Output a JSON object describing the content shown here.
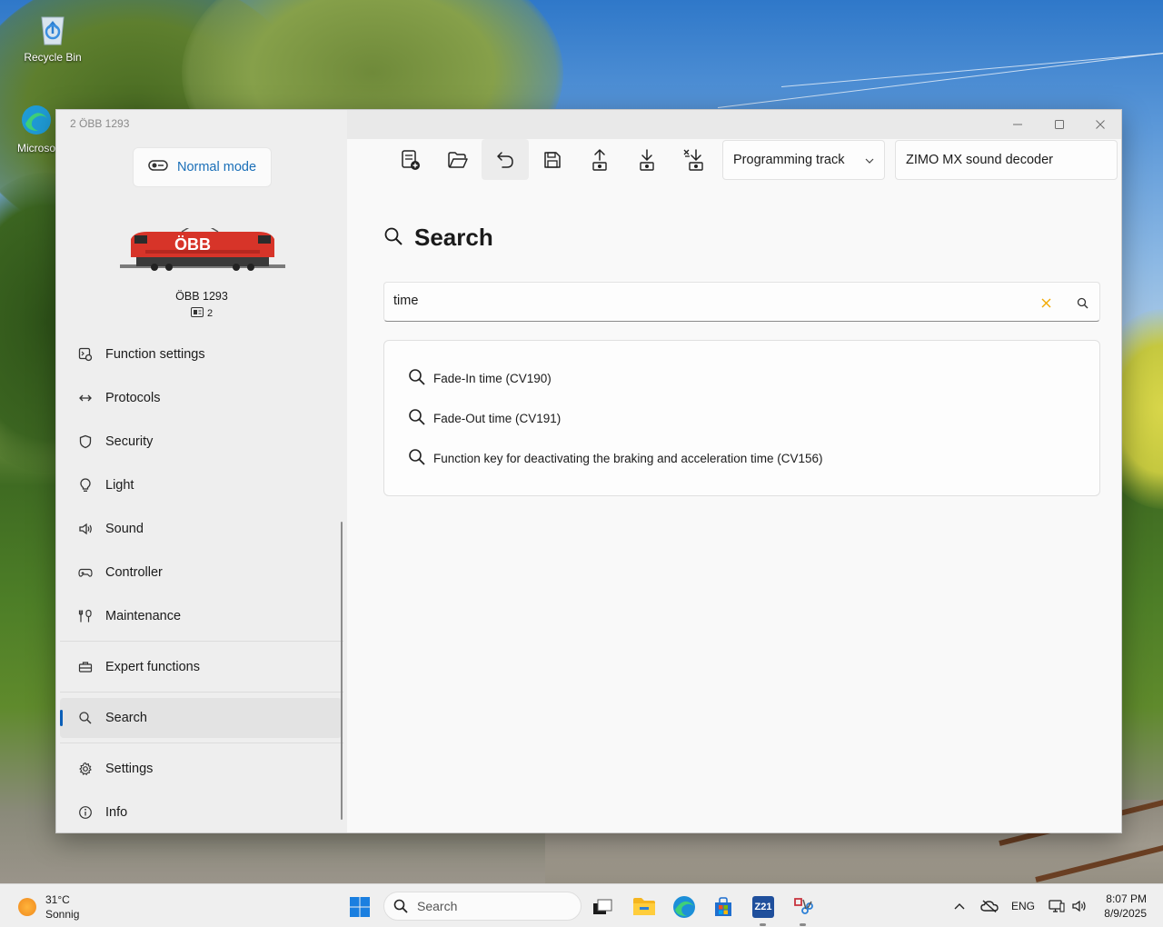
{
  "desktop": {
    "icons": [
      {
        "label": "Recycle Bin"
      },
      {
        "label": "Microso"
      }
    ]
  },
  "window": {
    "title": "2 ÖBB 1293",
    "controls": {
      "minimize": "minimize",
      "maximize": "maximize",
      "close": "close"
    }
  },
  "sidebar": {
    "mode_label": "Normal mode",
    "loco": {
      "name": "ÖBB 1293",
      "address": "2",
      "logo_text": "ÖBB"
    },
    "items": [
      {
        "label": "Function settings",
        "icon": "function-settings-icon"
      },
      {
        "label": "Protocols",
        "icon": "protocols-icon"
      },
      {
        "label": "Security",
        "icon": "shield-icon"
      },
      {
        "label": "Light",
        "icon": "lightbulb-icon"
      },
      {
        "label": "Sound",
        "icon": "speaker-icon"
      },
      {
        "label": "Controller",
        "icon": "gamepad-icon"
      },
      {
        "label": "Maintenance",
        "icon": "wrench-icon"
      },
      {
        "label": "Expert functions",
        "icon": "toolbox-icon"
      },
      {
        "label": "Search",
        "icon": "search-icon",
        "selected": true
      },
      {
        "label": "Settings",
        "icon": "gear-icon"
      },
      {
        "label": "Info",
        "icon": "info-icon"
      }
    ]
  },
  "toolbar": {
    "buttons": [
      "new-file",
      "open-folder",
      "undo",
      "save",
      "upload",
      "download",
      "download-settings"
    ],
    "track_select": "Programming track",
    "decoder_select": "ZIMO MX sound decoder"
  },
  "main": {
    "title": "Search",
    "search": {
      "value": "time"
    },
    "results": [
      "Fade-In time (CV190)",
      "Fade-Out time (CV191)",
      "Function key for deactivating the braking and acceleration time (CV156)"
    ]
  },
  "taskbar": {
    "weather": {
      "temp": "31°C",
      "condition": "Sonnig"
    },
    "search_label": "Search",
    "app_label": "Z21",
    "language": "ENG",
    "time": "8:07 PM",
    "date": "8/9/2025"
  },
  "colors": {
    "accent": "#0b5fb8",
    "link": "#1a6fb8",
    "clear": "#f2a900"
  }
}
